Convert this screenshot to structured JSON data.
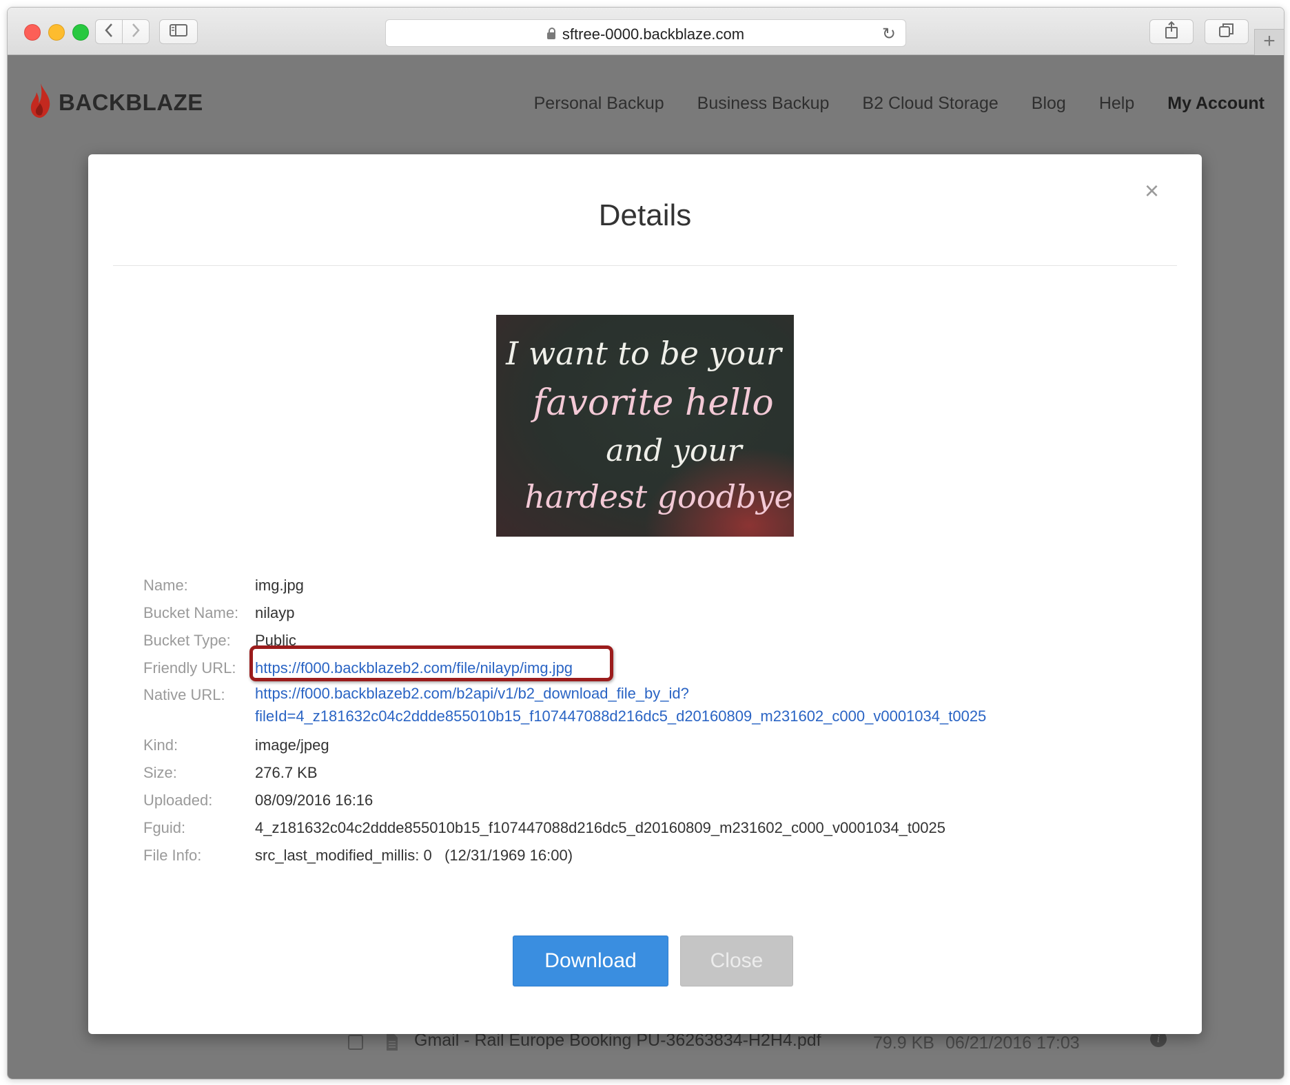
{
  "browser": {
    "url": "sftree-0000.backblaze.com"
  },
  "site": {
    "logo_text": "BACKBLAZE",
    "nav": [
      "Personal Backup",
      "Business Backup",
      "B2 Cloud Storage",
      "Blog",
      "Help",
      "My Account"
    ]
  },
  "modal": {
    "title": "Details",
    "close_symbol": "×",
    "image_lines": [
      "I want to be your",
      "favorite hello",
      "and your",
      "hardest goodbye"
    ],
    "fields": {
      "name_label": "Name:",
      "name_value": "img.jpg",
      "bucket_name_label": "Bucket Name:",
      "bucket_name_value": "nilayp",
      "bucket_type_label": "Bucket Type:",
      "bucket_type_value": "Public",
      "friendly_url_label": "Friendly URL:",
      "friendly_url_value": "https://f000.backblazeb2.com/file/nilayp/img.jpg",
      "native_url_label": "Native URL:",
      "native_url_line1": "https://f000.backblazeb2.com/b2api/v1/b2_download_file_by_id?",
      "native_url_line2": "fileId=4_z181632c04c2ddde855010b15_f107447088d216dc5_d20160809_m231602_c000_v0001034_t0025",
      "kind_label": "Kind:",
      "kind_value": "image/jpeg",
      "size_label": "Size:",
      "size_value": "276.7 KB",
      "uploaded_label": "Uploaded:",
      "uploaded_value": "08/09/2016 16:16",
      "fguid_label": "Fguid:",
      "fguid_value": "4_z181632c04c2ddde855010b15_f107447088d216dc5_d20160809_m231602_c000_v0001034_t0025",
      "file_info_label": "File Info:",
      "file_info_value": "src_last_modified_millis: 0   (12/31/1969 16:00)"
    },
    "download_label": "Download",
    "close_label": "Close"
  },
  "background_row": {
    "filename": "Gmail - Rail Europe Booking PU-36263834-H2H4.pdf",
    "size": "79.9 KB",
    "date": "06/21/2016 17:03"
  },
  "colors": {
    "accent": "#3a8ee0",
    "link": "#2a64c4",
    "highlight": "#9b1c1c",
    "brand_flame": "#c4291f"
  }
}
